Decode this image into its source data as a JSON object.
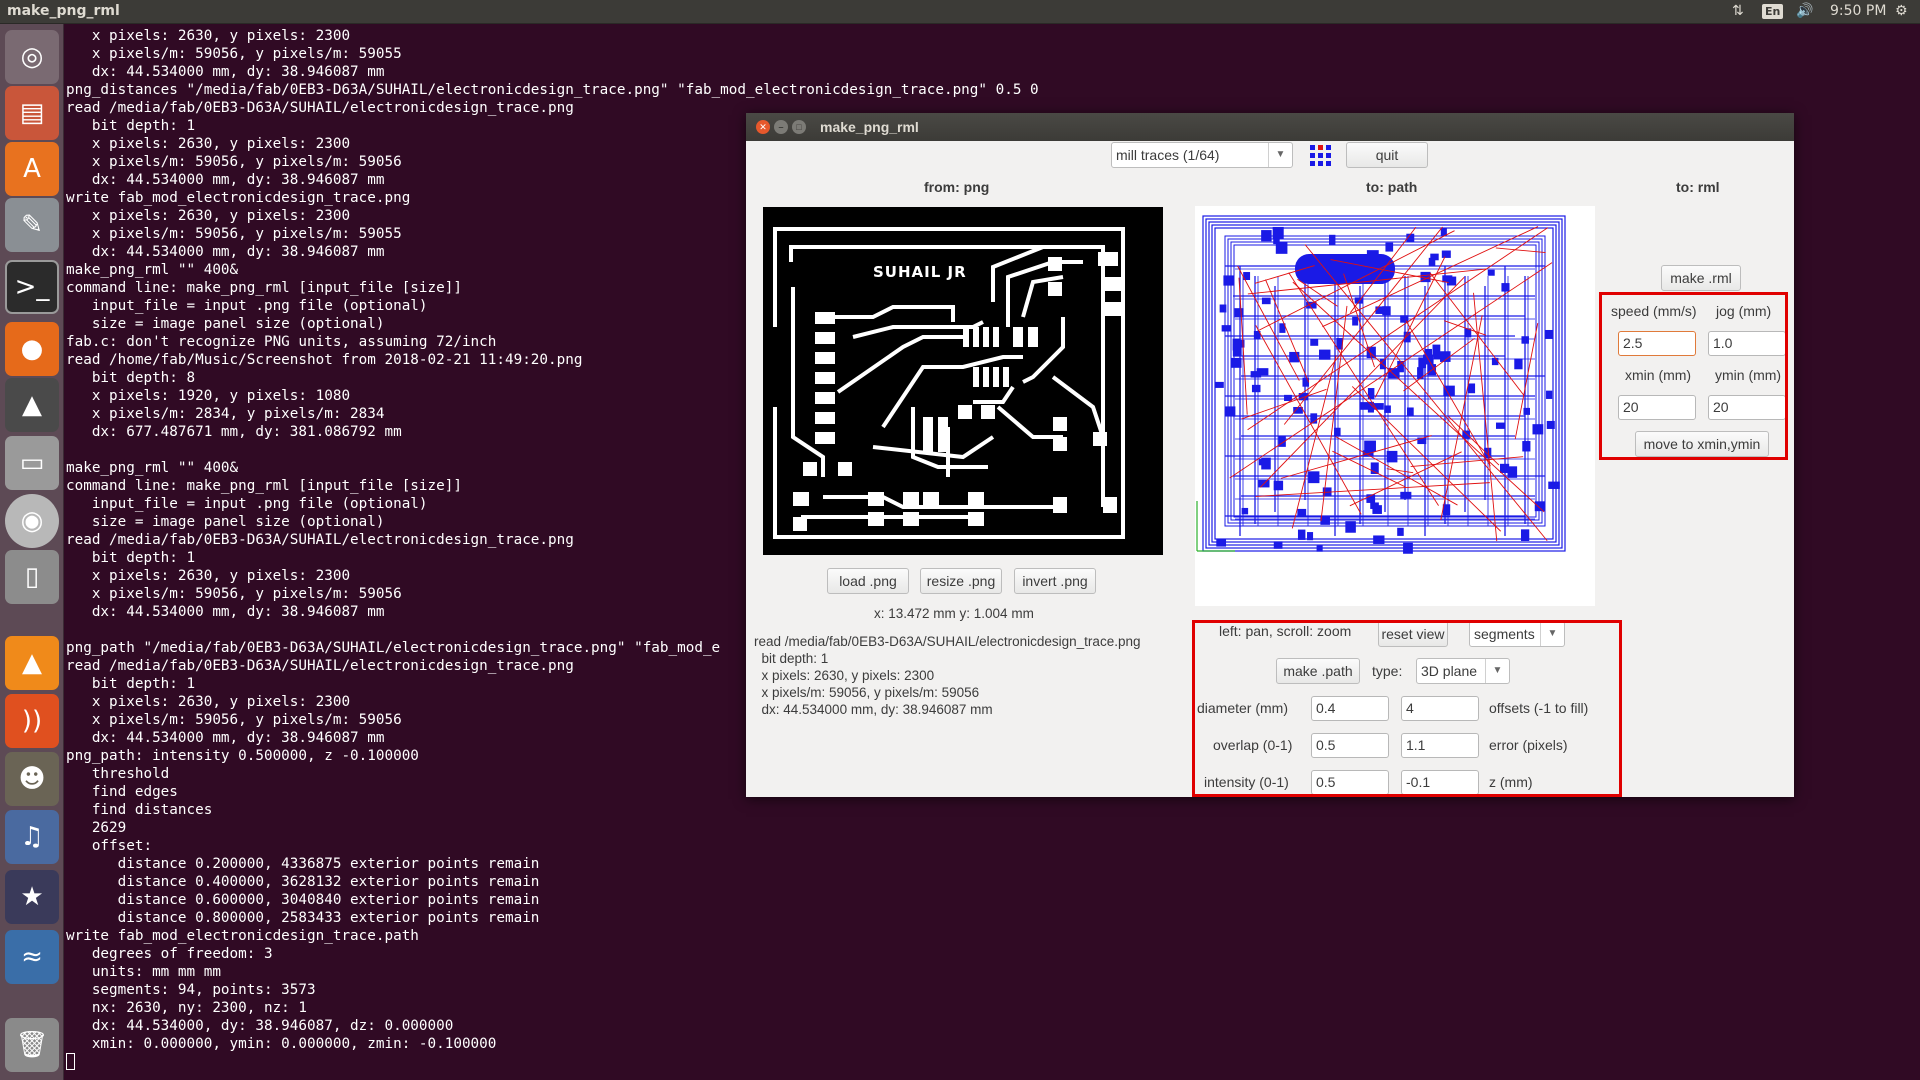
{
  "top_panel": {
    "app_title": "make_png_rml",
    "keyboard_layout": "En",
    "time": "9:50 PM"
  },
  "launcher": {
    "items": [
      {
        "name": "dash-icon"
      },
      {
        "name": "files-icon"
      },
      {
        "name": "software-center-icon"
      },
      {
        "name": "system-settings-icon"
      },
      {
        "name": "terminal-icon"
      },
      {
        "name": "firefox-icon"
      },
      {
        "name": "inkscape-icon"
      },
      {
        "name": "drive-icon"
      },
      {
        "name": "dvd-icon"
      },
      {
        "name": "usb-icon"
      },
      {
        "name": "vlc-icon"
      },
      {
        "name": "rss-icon"
      },
      {
        "name": "gimp-icon"
      },
      {
        "name": "media-icon"
      },
      {
        "name": "movie-icon"
      },
      {
        "name": "python-icon"
      },
      {
        "name": "trash-icon"
      }
    ]
  },
  "terminal": {
    "lines": [
      "   x pixels: 2630, y pixels: 2300",
      "   x pixels/m: 59056, y pixels/m: 59055",
      "   dx: 44.534000 mm, dy: 38.946087 mm",
      "png_distances \"/media/fab/0EB3-D63A/SUHAIL/electronicdesign_trace.png\" \"fab_mod_electronicdesign_trace.png\" 0.5 0",
      "read /media/fab/0EB3-D63A/SUHAIL/electronicdesign_trace.png",
      "   bit depth: 1",
      "   x pixels: 2630, y pixels: 2300",
      "   x pixels/m: 59056, y pixels/m: 59056",
      "   dx: 44.534000 mm, dy: 38.946087 mm",
      "write fab_mod_electronicdesign_trace.png",
      "   x pixels: 2630, y pixels: 2300",
      "   x pixels/m: 59056, y pixels/m: 59055",
      "   dx: 44.534000 mm, dy: 38.946087 mm",
      "make_png_rml \"\" 400&",
      "command line: make_png_rml [input_file [size]]",
      "   input_file = input .png file (optional)",
      "   size = image panel size (optional)",
      "fab.c: don't recognize PNG units, assuming 72/inch",
      "read /home/fab/Music/Screenshot from 2018-02-21 11:49:20.png",
      "   bit depth: 8",
      "   x pixels: 1920, y pixels: 1080",
      "   x pixels/m: 2834, y pixels/m: 2834",
      "   dx: 677.487671 mm, dy: 381.086792 mm",
      "",
      "make_png_rml \"\" 400&",
      "command line: make_png_rml [input_file [size]]",
      "   input_file = input .png file (optional)",
      "   size = image panel size (optional)",
      "read /media/fab/0EB3-D63A/SUHAIL/electronicdesign_trace.png",
      "   bit depth: 1",
      "   x pixels: 2630, y pixels: 2300",
      "   x pixels/m: 59056, y pixels/m: 59056",
      "   dx: 44.534000 mm, dy: 38.946087 mm",
      "",
      "png_path \"/media/fab/0EB3-D63A/SUHAIL/electronicdesign_trace.png\" \"fab_mod_e",
      "read /media/fab/0EB3-D63A/SUHAIL/electronicdesign_trace.png",
      "   bit depth: 1",
      "   x pixels: 2630, y pixels: 2300",
      "   x pixels/m: 59056, y pixels/m: 59056",
      "   dx: 44.534000 mm, dy: 38.946087 mm",
      "png_path: intensity 0.500000, z -0.100000",
      "   threshold",
      "   find edges",
      "   find distances",
      "   2629",
      "   offset:",
      "      distance 0.200000, 4336875 exterior points remain",
      "      distance 0.400000, 3628132 exterior points remain",
      "      distance 0.600000, 3040840 exterior points remain",
      "      distance 0.800000, 2583433 exterior points remain",
      "write fab_mod_electronicdesign_trace.path",
      "   degrees of freedom: 3",
      "   units: mm mm mm",
      "   segments: 94, points: 3573",
      "   nx: 2630, ny: 2300, nz: 1",
      "   dx: 44.534000, dy: 38.946087, dz: 0.000000",
      "   xmin: 0.000000, ymin: 0.000000, zmin: -0.100000"
    ]
  },
  "window": {
    "title": "make_png_rml",
    "mode_select": "mill traces (1/64)",
    "quit_label": "quit",
    "headers": {
      "from_png": "from: png",
      "to_path": "to: path",
      "to_rml": "to: rml"
    },
    "pcb_label": "SUHAIL JR",
    "buttons": {
      "load_png": "load .png",
      "resize_png": "resize .png",
      "invert_png": "invert .png"
    },
    "coords": "x: 13.472 mm  y: 1.004 mm",
    "info_lines": [
      "read /media/fab/0EB3-D63A/SUHAIL/electronicdesign_trace.png",
      "  bit depth: 1",
      "  x pixels: 2630, y pixels: 2300",
      "  x pixels/m: 59056, y pixels/m: 59056",
      "  dx: 44.534000 mm, dy: 38.946087 mm"
    ],
    "path_controls": {
      "hint": "left: pan, scroll: zoom",
      "reset_view": "reset view",
      "view_select": "segments",
      "make_path": "make .path",
      "type_label": "type:",
      "type_select": "3D plane",
      "diameter_label": "diameter (mm)",
      "diameter_value": "0.4",
      "offsets_value": "4",
      "offsets_label": "offsets (-1 to fill)",
      "overlap_label": "overlap (0-1)",
      "overlap_value": "0.5",
      "error_value": "1.1",
      "error_label": "error (pixels)",
      "intensity_label": "intensity (0-1)",
      "intensity_value": "0.5",
      "z_value": "-0.1",
      "z_label": "z (mm)"
    },
    "rml_controls": {
      "make_rml": "make .rml",
      "speed_label": "speed (mm/s)",
      "jog_label": "jog (mm)",
      "speed_value": "2.5",
      "jog_value": "1.0",
      "xmin_label": "xmin (mm)",
      "ymin_label": "ymin (mm)",
      "xmin_value": "20",
      "ymin_value": "20",
      "move_button": "move to xmin,ymin"
    }
  },
  "colors": {
    "terminal_bg": "#300a24",
    "annotation_red": "#e00000",
    "path_blue": "#1a1ae6",
    "path_red": "#e01010"
  }
}
